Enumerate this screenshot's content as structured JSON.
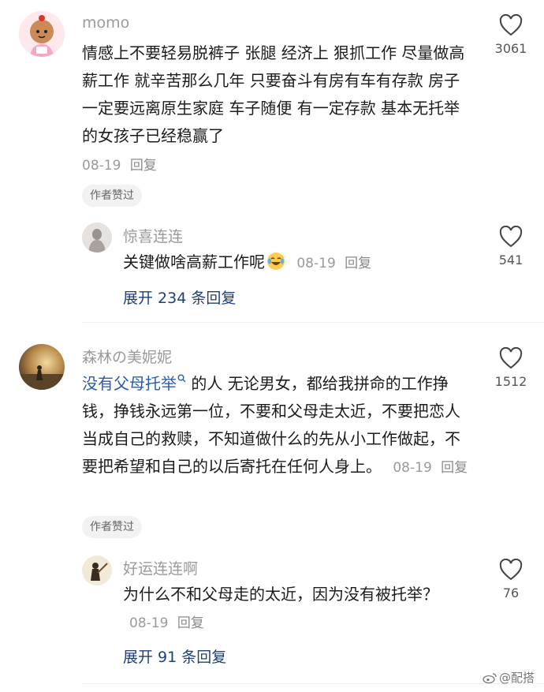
{
  "comments": [
    {
      "username": "momo",
      "text": "情感上不要轻易脱裤子 张腿 经济上 狠抓工作 尽量做高薪工作 就辛苦那么几年 只要奋斗有房有车有存款 房子一定要远离原生家庭 车子随便 有一定存款 基本无托举的女孩子已经稳赢了",
      "date": "08-19",
      "reply_label": "回复",
      "likes": "3061",
      "author_liked": "作者赞过",
      "avatar_icon": "cartoon-girl-avatar",
      "sub_reply": {
        "username": "惊喜连连",
        "text": "关键做啥高薪工作呢",
        "emoji": "crying-laughing-emoji",
        "date": "08-19",
        "reply_label": "回复",
        "likes": "541",
        "avatar_icon": "silhouette-avatar"
      },
      "expand_label": "展开 234 条回复"
    },
    {
      "username": "森林の美妮妮",
      "link_text": "没有父母托举",
      "text": " 的人 无论男女，都给我拼命的工作挣钱，挣钱永远第一位，不要和父母走太近，不要把恋人当成自己的救赎，不知道做什么的先从小工作做起，不要把希望和自己的以后寄托在任何人身上。",
      "date": "08-19",
      "reply_label": "回复",
      "likes": "1512",
      "author_liked": "作者赞过",
      "avatar_icon": "sunset-field-avatar",
      "sub_reply": {
        "username": "好运连连啊",
        "text": "为什么不和父母走的太近，因为没有被托举？",
        "date": "08-19",
        "reply_label": "回复",
        "likes": "76",
        "avatar_icon": "girl-with-guitar-avatar"
      },
      "expand_label": "展开 91 条回复"
    }
  ],
  "watermark": "@配搭",
  "colors": {
    "link": "#2b5cab",
    "expand": "#1f3f7a",
    "muted": "#9a9a9a"
  }
}
